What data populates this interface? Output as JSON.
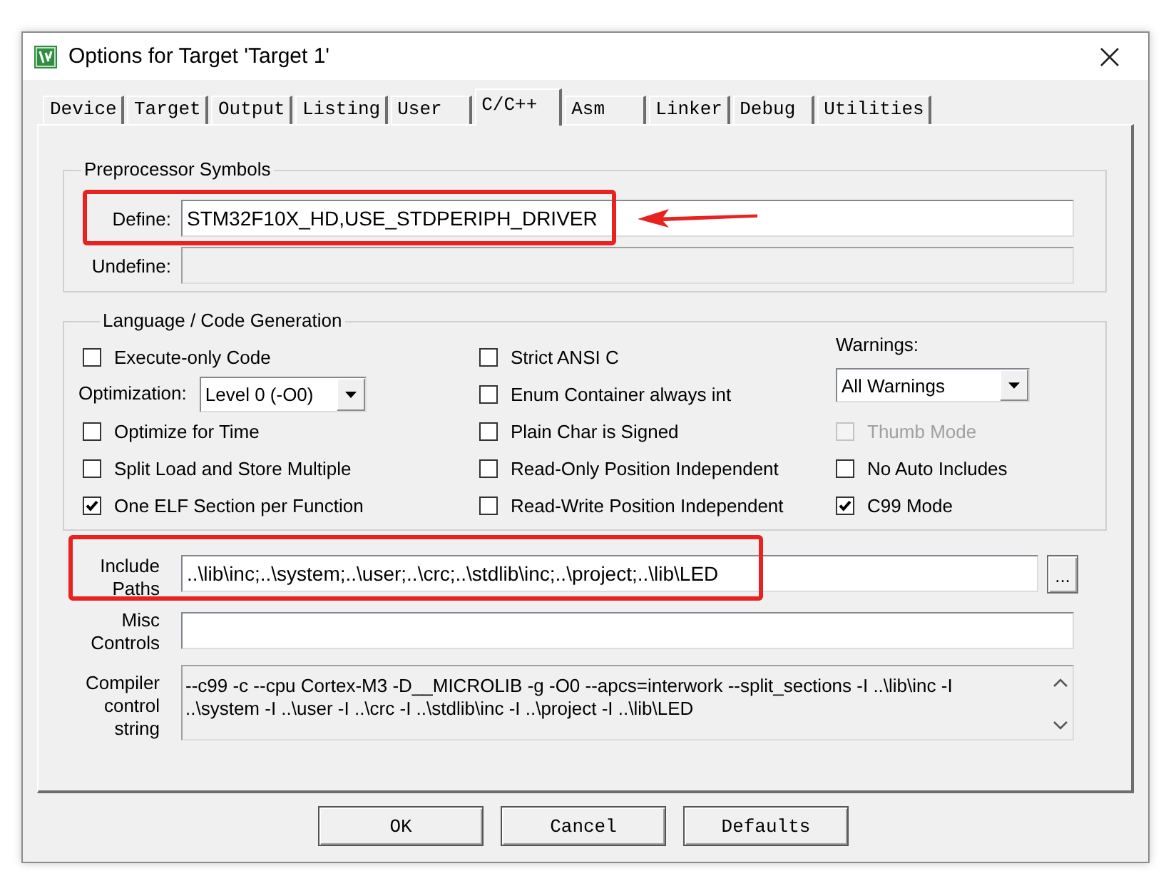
{
  "window": {
    "title": "Options for Target 'Target 1'"
  },
  "tabs": [
    {
      "label": "Device",
      "selected": false
    },
    {
      "label": "Target",
      "selected": false
    },
    {
      "label": "Output",
      "selected": false
    },
    {
      "label": "Listing",
      "selected": false
    },
    {
      "label": "User",
      "selected": false
    },
    {
      "label": "C/C++",
      "selected": true
    },
    {
      "label": "Asm",
      "selected": false
    },
    {
      "label": "Linker",
      "selected": false
    },
    {
      "label": "Debug",
      "selected": false
    },
    {
      "label": "Utilities",
      "selected": false
    }
  ],
  "preprocessor": {
    "title": "Preprocessor Symbols",
    "rows": [
      {
        "label": "Define:",
        "value": "STM32F10X_HD,USE_STDPERIPH_DRIVER",
        "disabled": false,
        "highlighted": true,
        "arrow": true
      },
      {
        "label": "Undefine:",
        "disabled": true,
        "highlighted": false,
        "arrow": false
      }
    ]
  },
  "language": {
    "title": "Language / Code Generation",
    "columns": [
      {
        "items": [
          {
            "kind": "checkbox",
            "label": "Execute-only Code",
            "checked": false,
            "disabled": false
          },
          {
            "kind": "inline-select",
            "label": "Optimization:",
            "value": "Level 0 (-O0)"
          },
          {
            "kind": "checkbox",
            "label": "Optimize for Time",
            "checked": false,
            "disabled": false
          },
          {
            "kind": "checkbox",
            "label": "Split Load and Store Multiple",
            "checked": false,
            "disabled": false
          },
          {
            "kind": "checkbox",
            "label": "One ELF Section per Function",
            "checked": true,
            "disabled": false
          }
        ]
      },
      {
        "items": [
          {
            "kind": "checkbox",
            "label": "Strict ANSI C",
            "checked": false,
            "disabled": false
          },
          {
            "kind": "checkbox",
            "label": "Enum Container always int",
            "checked": false,
            "disabled": false
          },
          {
            "kind": "checkbox",
            "label": "Plain Char is Signed",
            "checked": false,
            "disabled": false
          },
          {
            "kind": "checkbox",
            "label": "Read-Only Position Independent",
            "checked": false,
            "disabled": false
          },
          {
            "kind": "checkbox",
            "label": "Read-Write Position Independent",
            "checked": false,
            "disabled": false
          }
        ]
      },
      {
        "items": [
          {
            "kind": "stacked-select",
            "label": "Warnings:",
            "value": "All Warnings"
          },
          {
            "kind": "checkbox",
            "label": "Thumb Mode",
            "checked": false,
            "disabled": true
          },
          {
            "kind": "checkbox",
            "label": "No Auto Includes",
            "checked": false,
            "disabled": false
          },
          {
            "kind": "checkbox",
            "label": "C99 Mode",
            "checked": true,
            "disabled": false
          }
        ]
      }
    ]
  },
  "paths": [
    {
      "kind": "browse",
      "label": "Include Paths",
      "value": "..\\lib\\inc;..\\system;..\\user;..\\crc;..\\stdlib\\inc;..\\project;..\\lib\\LED",
      "button": "...",
      "highlighted": true
    },
    {
      "kind": "input",
      "label": "Misc Controls",
      "highlighted": false
    },
    {
      "kind": "scroll",
      "label": "Compiler control string",
      "value": "--c99 -c --cpu Cortex-M3 -D__MICROLIB -g -O0 --apcs=interwork --split_sections -I ..\\lib\\inc -I ..\\system -I ..\\user -I ..\\crc -I ..\\stdlib\\inc -I ..\\project -I ..\\lib\\LED",
      "highlighted": false
    }
  ],
  "buttons": [
    {
      "label": "OK"
    },
    {
      "label": "Cancel"
    },
    {
      "label": "Defaults"
    }
  ]
}
